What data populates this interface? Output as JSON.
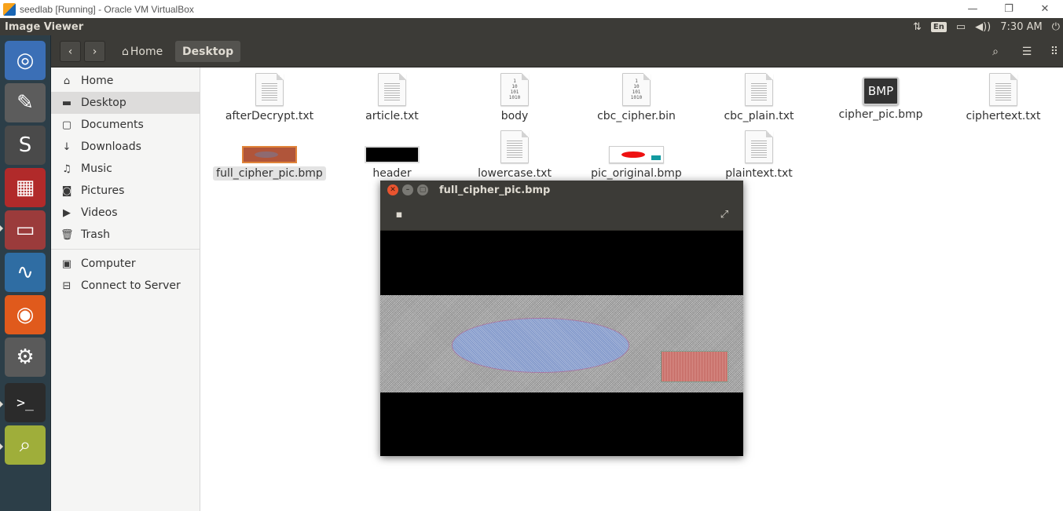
{
  "host_window": {
    "title": "seedlab [Running] - Oracle VM VirtualBox",
    "controls": {
      "minimize": "—",
      "restore": "❐",
      "close": "✕"
    }
  },
  "top_panel": {
    "app_name": "Image Viewer",
    "network_icon": "⇅",
    "language": "En",
    "battery_icon": "▭",
    "volume_icon": "◀))",
    "time": "7:30 AM",
    "power_icon": "⏻"
  },
  "launcher": {
    "items": [
      {
        "name": "ubuntu-dash-icon",
        "glyph": "◎",
        "color": "#3b6fb6"
      },
      {
        "name": "text-editor-icon",
        "glyph": "✎",
        "color": "#5c5c5c"
      },
      {
        "name": "sublime-text-icon",
        "glyph": "S",
        "color": "#4a4a4a"
      },
      {
        "name": "ghex-icon",
        "glyph": "▦",
        "color": "#b12a2a"
      },
      {
        "name": "files-icon",
        "glyph": "▭",
        "color": "#9b3b3b"
      },
      {
        "name": "wireshark-icon",
        "glyph": "∿",
        "color": "#2f6da3"
      },
      {
        "name": "firefox-icon",
        "glyph": "◉",
        "color": "#e05a1c"
      },
      {
        "name": "system-settings-icon",
        "glyph": "⚙",
        "color": "#5a5a5a"
      },
      {
        "name": "terminal-icon",
        "glyph": ">_",
        "color": "#2b2b2b"
      },
      {
        "name": "image-viewer-icon",
        "glyph": "⌕",
        "color": "#9fae3a"
      }
    ]
  },
  "nav": {
    "back": "‹",
    "forward": "›",
    "home_label": "Home",
    "home_icon": "⌂",
    "current": "Desktop",
    "search_icon": "⌕",
    "list_icon": "☰",
    "grid_icon": "⠿"
  },
  "sidebar": {
    "items": [
      {
        "label": "Home",
        "icon": "⌂"
      },
      {
        "label": "Desktop",
        "icon": "▬"
      },
      {
        "label": "Documents",
        "icon": "▢"
      },
      {
        "label": "Downloads",
        "icon": "↓"
      },
      {
        "label": "Music",
        "icon": "♫"
      },
      {
        "label": "Pictures",
        "icon": "◙"
      },
      {
        "label": "Videos",
        "icon": "▶"
      },
      {
        "label": "Trash",
        "icon": "🗑"
      }
    ],
    "other": [
      {
        "label": "Computer",
        "icon": "▣"
      },
      {
        "label": "Connect to Server",
        "icon": "⊟"
      }
    ]
  },
  "files": [
    {
      "name": "afterDecrypt.txt",
      "type": "text"
    },
    {
      "name": "article.txt",
      "type": "text"
    },
    {
      "name": "body",
      "type": "binary"
    },
    {
      "name": "cbc_cipher.bin",
      "type": "binary"
    },
    {
      "name": "cbc_plain.txt",
      "type": "text"
    },
    {
      "name": "cipher_pic.bmp",
      "type": "bmp",
      "badge": "BMP"
    },
    {
      "name": "ciphertext.txt",
      "type": "text"
    },
    {
      "name": "full_cipher_pic.bmp",
      "type": "thumb-cipher"
    },
    {
      "name": "header",
      "type": "thumb-black"
    },
    {
      "name": "lowercase.txt",
      "type": "text"
    },
    {
      "name": "pic_original.bmp",
      "type": "thumb-original"
    },
    {
      "name": "plaintext.txt",
      "type": "text"
    }
  ],
  "binary_glyph": "1\n10\n101\n1010",
  "viewer": {
    "title": "full_cipher_pic.bmp",
    "close_glyph": "✕",
    "min_glyph": "–",
    "max_glyph": "▢",
    "menu_icon": "▪",
    "fullscreen_icon": "⤢"
  }
}
